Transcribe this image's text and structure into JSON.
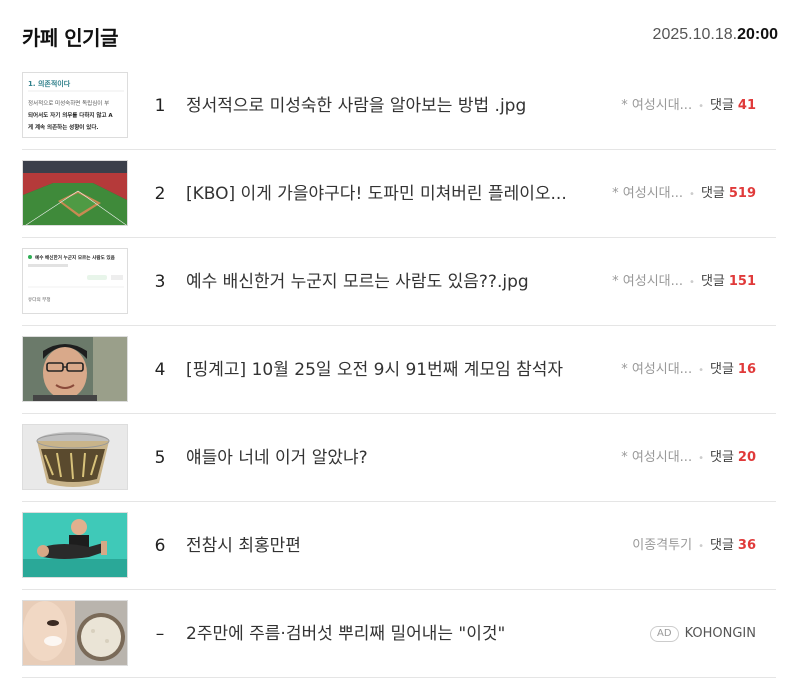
{
  "header": {
    "title": "카페 인기글",
    "date": "2025.10.18.",
    "time": "20:00"
  },
  "posts": [
    {
      "rank": "1",
      "title": "정서적으로 미성숙한 사람을 알아보는 방법 .jpg",
      "cafe": "* 여성시대...",
      "comment_label": "댓글",
      "comments": "41",
      "thumb": {
        "heading": "1. 의존적이다",
        "line1": "정서적으로 미성숙하면 독립심이 부",
        "line2": "되어서도 자기 의무를 다하지 않고 A",
        "line3": "게 계속 의존하는 성향이 있다."
      }
    },
    {
      "rank": "2",
      "title": "[KBO] 이게 가을야구다! 도파민 미쳐버린 플레이오...",
      "cafe": "* 여성시대...",
      "comment_label": "댓글",
      "comments": "519"
    },
    {
      "rank": "3",
      "title": "예수 배신한거 누군지 모르는 사람도 있음??.jpg",
      "cafe": "* 여성시대...",
      "comment_label": "댓글",
      "comments": "151",
      "thumb": {
        "line1": "예수 배신한거 누군지 모르는 사람도 있음",
        "line2": "유다의 부정"
      }
    },
    {
      "rank": "4",
      "title": "[핑계고] 10월 25일 오전 9시 91번째 계모임 참석자",
      "cafe": "* 여성시대...",
      "comment_label": "댓글",
      "comments": "16"
    },
    {
      "rank": "5",
      "title": "얘들아 너네 이거 알았냐?",
      "cafe": "* 여성시대...",
      "comment_label": "댓글",
      "comments": "20"
    },
    {
      "rank": "6",
      "title": "전참시 최홍만편",
      "cafe": "이종격투기",
      "comment_label": "댓글",
      "comments": "36"
    }
  ],
  "ad": {
    "rank": "–",
    "title": "2주만에 주름·검버섯 뿌리째 밀어내는 \"이것\"",
    "badge": "AD",
    "advertiser": "KOHONGIN"
  },
  "colors": {
    "comment_count": "#e03a3a",
    "divider": "#e5e5e5"
  }
}
